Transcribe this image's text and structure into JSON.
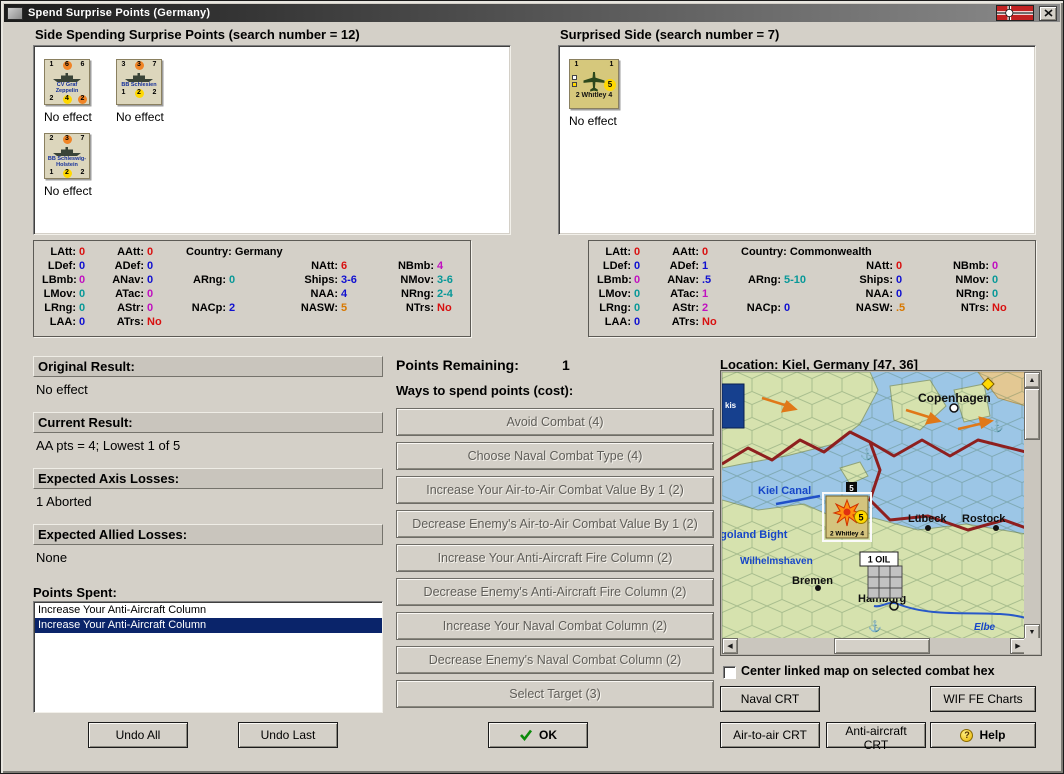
{
  "window": {
    "title": "Spend Surprise Points (Germany)"
  },
  "icons": {
    "close": "✕",
    "help": "?",
    "ok_check": "✓",
    "anchor": "⚓",
    "scroll_up": "▲",
    "scroll_down": "▼",
    "scroll_left": "◀",
    "scroll_right": "▶"
  },
  "palette": {
    "red": "#d81010",
    "magenta": "#c010c0",
    "blue": "#1010d0",
    "teal": "#089898",
    "orange": "#d87800",
    "black": "#000000",
    "selection_bg": "#0a246a",
    "selection_fg": "#ffffff"
  },
  "spender": {
    "header": "Side Spending Surprise Points (search number = 12)",
    "units": [
      {
        "kind": "ship",
        "name": "CV Graf Zeppelin",
        "top": [
          [
            "1",
            ""
          ],
          [
            "6",
            "orange"
          ],
          [
            "6",
            ""
          ]
        ],
        "bottom": [
          [
            "2",
            ""
          ],
          [
            "4",
            "yellow"
          ],
          [
            "2",
            "orange"
          ]
        ],
        "result": "No effect"
      },
      {
        "kind": "ship",
        "name": "BB Schlesien",
        "top": [
          [
            "3",
            ""
          ],
          [
            "3",
            "orange"
          ],
          [
            "7",
            ""
          ]
        ],
        "bottom": [
          [
            "1",
            ""
          ],
          [
            "2",
            "yellow"
          ],
          [
            "2",
            ""
          ]
        ],
        "result": "No effect"
      },
      {
        "kind": "ship",
        "name": "BB Schleswig-Holstein",
        "top": [
          [
            "2",
            ""
          ],
          [
            "3",
            "orange"
          ],
          [
            "7",
            ""
          ]
        ],
        "bottom": [
          [
            "1",
            ""
          ],
          [
            "2",
            "yellow"
          ],
          [
            "2",
            ""
          ]
        ],
        "result": "No effect"
      }
    ],
    "stats": [
      {
        "c": 0,
        "r": 0,
        "l": "LAtt:",
        "v": "0",
        "k": "red"
      },
      {
        "c": 0,
        "r": 1,
        "l": "LDef:",
        "v": "0",
        "k": "blue"
      },
      {
        "c": 0,
        "r": 2,
        "l": "LBmb:",
        "v": "0",
        "k": "magenta"
      },
      {
        "c": 0,
        "r": 3,
        "l": "LMov:",
        "v": "0",
        "k": "teal"
      },
      {
        "c": 0,
        "r": 4,
        "l": "LRng:",
        "v": "0",
        "k": "teal"
      },
      {
        "c": 0,
        "r": 5,
        "l": "LAA:",
        "v": "0",
        "k": "blue"
      },
      {
        "c": 1,
        "r": 0,
        "l": "AAtt:",
        "v": "0",
        "k": "red"
      },
      {
        "c": 1,
        "r": 1,
        "l": "ADef:",
        "v": "0",
        "k": "blue"
      },
      {
        "c": 1,
        "r": 2,
        "l": "ANav:",
        "v": "0",
        "k": "blue"
      },
      {
        "c": 1,
        "r": 3,
        "l": "ATac:",
        "v": "0",
        "k": "magenta"
      },
      {
        "c": 1,
        "r": 4,
        "l": "AStr:",
        "v": "0",
        "k": "magenta"
      },
      {
        "c": 1,
        "r": 5,
        "l": "ATrs:",
        "v": "No",
        "k": "red"
      },
      {
        "c": 2,
        "r": 0,
        "l": "Country: Germany",
        "v": "",
        "k": "black",
        "wide": true
      },
      {
        "c": 2,
        "r": 2,
        "l": "ARng:",
        "v": "0",
        "k": "teal"
      },
      {
        "c": 2,
        "r": 4,
        "l": "NACp:",
        "v": "2",
        "k": "blue"
      },
      {
        "c": 3,
        "r": 1,
        "l": "NAtt:",
        "v": "6",
        "k": "red"
      },
      {
        "c": 3,
        "r": 2,
        "l": "Ships:",
        "v": "3-6",
        "k": "blue"
      },
      {
        "c": 3,
        "r": 3,
        "l": "NAA:",
        "v": "4",
        "k": "blue"
      },
      {
        "c": 3,
        "r": 4,
        "l": "NASW:",
        "v": "5",
        "k": "orange"
      },
      {
        "c": 4,
        "r": 1,
        "l": "NBmb:",
        "v": "4",
        "k": "magenta"
      },
      {
        "c": 4,
        "r": 2,
        "l": "NMov:",
        "v": "3-6",
        "k": "teal"
      },
      {
        "c": 4,
        "r": 3,
        "l": "NRng:",
        "v": "2-4",
        "k": "teal"
      },
      {
        "c": 4,
        "r": 4,
        "l": "NTrs:",
        "v": "No",
        "k": "red"
      }
    ]
  },
  "surprised": {
    "header": "Surprised Side (search number = 7)",
    "units": [
      {
        "kind": "air",
        "name": "2 Whitley 4",
        "top": [
          [
            "1",
            ""
          ],
          [
            "",
            ""
          ],
          [
            "1",
            ""
          ]
        ],
        "side": [
          "5",
          "yellow"
        ],
        "result": "No effect"
      }
    ],
    "stats": [
      {
        "c": 0,
        "r": 0,
        "l": "LAtt:",
        "v": "0",
        "k": "red"
      },
      {
        "c": 0,
        "r": 1,
        "l": "LDef:",
        "v": "0",
        "k": "blue"
      },
      {
        "c": 0,
        "r": 2,
        "l": "LBmb:",
        "v": "0",
        "k": "magenta"
      },
      {
        "c": 0,
        "r": 3,
        "l": "LMov:",
        "v": "0",
        "k": "teal"
      },
      {
        "c": 0,
        "r": 4,
        "l": "LRng:",
        "v": "0",
        "k": "teal"
      },
      {
        "c": 0,
        "r": 5,
        "l": "LAA:",
        "v": "0",
        "k": "blue"
      },
      {
        "c": 1,
        "r": 0,
        "l": "AAtt:",
        "v": "0",
        "k": "red"
      },
      {
        "c": 1,
        "r": 1,
        "l": "ADef:",
        "v": "1",
        "k": "blue"
      },
      {
        "c": 1,
        "r": 2,
        "l": "ANav:",
        "v": ".5",
        "k": "blue"
      },
      {
        "c": 1,
        "r": 3,
        "l": "ATac:",
        "v": "1",
        "k": "magenta"
      },
      {
        "c": 1,
        "r": 4,
        "l": "AStr:",
        "v": "2",
        "k": "magenta"
      },
      {
        "c": 1,
        "r": 5,
        "l": "ATrs:",
        "v": "No",
        "k": "red"
      },
      {
        "c": 2,
        "r": 0,
        "l": "Country: Commonwealth",
        "v": "",
        "k": "black",
        "wide": true
      },
      {
        "c": 2,
        "r": 2,
        "l": "ARng:",
        "v": "5-10",
        "k": "teal"
      },
      {
        "c": 2,
        "r": 4,
        "l": "NACp:",
        "v": "0",
        "k": "blue"
      },
      {
        "c": 3,
        "r": 1,
        "l": "NAtt:",
        "v": "0",
        "k": "red"
      },
      {
        "c": 3,
        "r": 2,
        "l": "Ships:",
        "v": "0",
        "k": "blue"
      },
      {
        "c": 3,
        "r": 3,
        "l": "NAA:",
        "v": "0",
        "k": "blue"
      },
      {
        "c": 3,
        "r": 4,
        "l": "NASW:",
        "v": ".5",
        "k": "orange"
      },
      {
        "c": 4,
        "r": 1,
        "l": "NBmb:",
        "v": "0",
        "k": "magenta"
      },
      {
        "c": 4,
        "r": 2,
        "l": "NMov:",
        "v": "0",
        "k": "teal"
      },
      {
        "c": 4,
        "r": 3,
        "l": "NRng:",
        "v": "0",
        "k": "teal"
      },
      {
        "c": 4,
        "r": 4,
        "l": "NTrs:",
        "v": "No",
        "k": "red"
      }
    ]
  },
  "results": {
    "sections": [
      {
        "label": "Original Result:",
        "value": "No effect"
      },
      {
        "label": "Current Result:",
        "value": "AA pts = 4; Lowest 1 of 5"
      },
      {
        "label": "Expected Axis Losses:",
        "value": "1 Aborted"
      },
      {
        "label": "Expected Allied Losses:",
        "value": "None"
      }
    ],
    "points_spent_label": "Points Spent:",
    "points_spent_items": [
      {
        "text": "Increase Your Anti-Aircraft Column",
        "selected": false
      },
      {
        "text": "Increase Your Anti-Aircraft Column",
        "selected": true
      }
    ],
    "undo_all_label": "Undo All",
    "undo_last_label": "Undo Last"
  },
  "spend": {
    "points_remaining_label": "Points Remaining:",
    "points_remaining_value": "1",
    "ways_label": "Ways to spend points (cost):",
    "buttons": [
      {
        "label": "Avoid Combat (4)",
        "enabled": false
      },
      {
        "label": "Choose Naval Combat Type (4)",
        "enabled": false
      },
      {
        "label": "Increase Your Air-to-Air Combat Value By 1 (2)",
        "enabled": false
      },
      {
        "label": "Decrease Enemy's Air-to-Air Combat Value By 1 (2)",
        "enabled": false
      },
      {
        "label": "Increase Your Anti-Aircraft Fire Column (2)",
        "enabled": false
      },
      {
        "label": "Decrease Enemy's Anti-Aircraft Fire Column (2)",
        "enabled": false
      },
      {
        "label": "Increase Your Naval Combat Column (2)",
        "enabled": false
      },
      {
        "label": "Decrease Enemy's Naval Combat Column (2)",
        "enabled": false
      },
      {
        "label": "Select Target (3)",
        "enabled": false
      }
    ],
    "ok_label": "OK"
  },
  "map_panel": {
    "location": "Location: Kiel, Germany [47, 36]",
    "checkbox_label": "Center linked map on selected combat hex",
    "checkbox_checked": false,
    "crt_buttons_row1": [
      {
        "label": "Naval CRT"
      },
      {
        "label": "WIF FE Charts"
      }
    ],
    "crt_buttons_row2": [
      {
        "label": "Air-to-air CRT"
      },
      {
        "label": "Anti-aircraft CRT"
      },
      {
        "label": "Help"
      }
    ],
    "map": {
      "labels": {
        "copenhagen": "Copenhagen",
        "kiel_canal": "Kiel Canal",
        "luebeck": "Lübeck",
        "rostock": "Rostock",
        "heligoland_bight": "Heligoland Bight",
        "wilhelmshaven": "Wilhelmshaven",
        "bremen": "Bremen",
        "hamburg": "Hamburg",
        "elbe": "Elbe",
        "corner_partial": "kis"
      },
      "markers": {
        "oil": "1 OIL",
        "stack_chip": "5",
        "counter_name": "2 Whitley 4",
        "counter_chip": "5"
      }
    }
  }
}
